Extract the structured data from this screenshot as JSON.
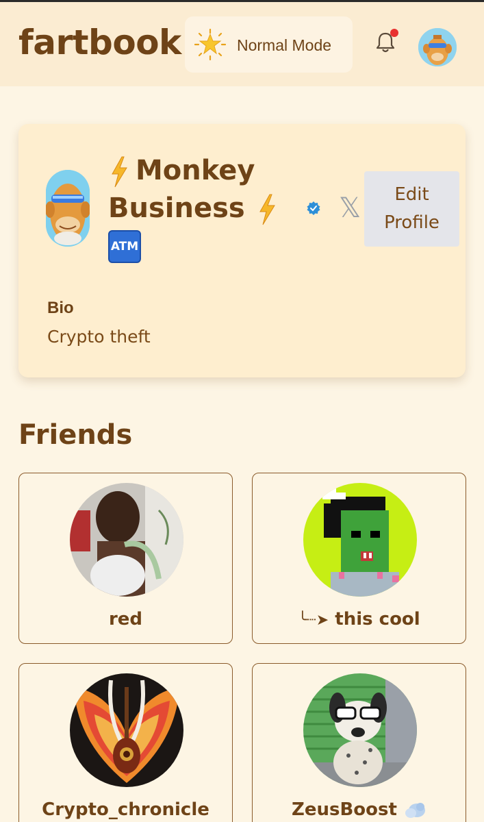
{
  "app": {
    "logo": "fartbook"
  },
  "header": {
    "mode_label": "Normal Mode",
    "notification_dot_color": "#e8312f"
  },
  "profile": {
    "name_line1": "Monkey",
    "name_line2": "Business",
    "edit_label_1": "Edit",
    "edit_label_2": "Profile",
    "bio_title": "Bio",
    "bio_text": "Crypto theft",
    "atm_label": "ATM",
    "x_glyph": "𝕏"
  },
  "friends": {
    "title": "Friends",
    "items": [
      {
        "name": "red"
      },
      {
        "prefix": "╰┈➤",
        "name": "this cool"
      },
      {
        "name": "Crypto_chronicle"
      },
      {
        "name": "ZeusBoost"
      }
    ]
  },
  "colors": {
    "background": "#fdf5e4",
    "header": "#fbecd2",
    "brand_text": "#6e4317",
    "accent_verified": "#2d8fd8"
  }
}
